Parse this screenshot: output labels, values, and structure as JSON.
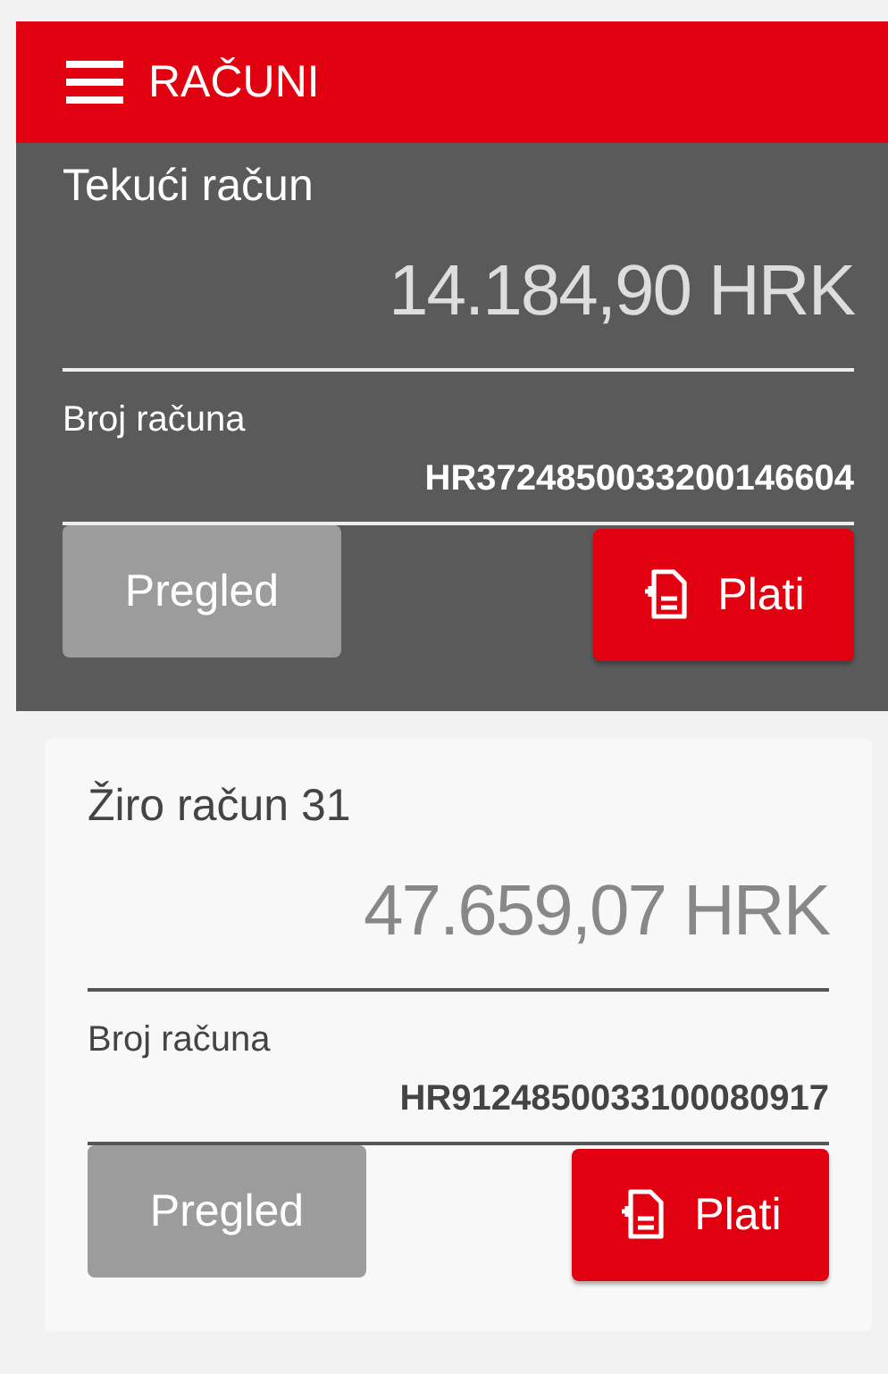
{
  "header": {
    "title": "RAČUNI"
  },
  "accounts": [
    {
      "name": "Tekući račun",
      "balance": "14.184,90 HRK",
      "number_label": "Broj računa",
      "number": "HR3724850033200146604",
      "view_button": "Pregled",
      "pay_button": "Plati",
      "selected": true
    },
    {
      "name": "Žiro račun 31",
      "balance": "47.659,07 HRK",
      "number_label": "Broj računa",
      "number": "HR9124850033100080917",
      "view_button": "Pregled",
      "pay_button": "Plati",
      "selected": false
    }
  ]
}
